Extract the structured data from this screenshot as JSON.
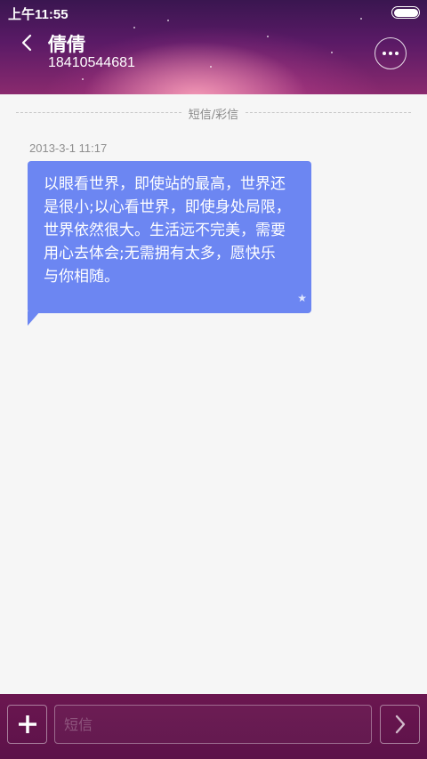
{
  "status_bar": {
    "time": "上午11:55",
    "battery_level": 1.0
  },
  "header": {
    "contact_name": "倩倩",
    "contact_number": "18410544681",
    "back_icon": "chevron-left-icon",
    "more_icon": "more-dots-icon"
  },
  "conversation": {
    "divider_label": "短信/彩信",
    "messages": [
      {
        "timestamp": "2013-3-1 11:17",
        "text": "以眼看世界，即使站的最高，世界还\n是很小;以心看世界，即使身处局限，\n世界依然很大。生活远不完美，需要\n用心去体会;无需拥有太多，愿快乐\n与你相随。",
        "starred": true,
        "bubble_color": "#6c86f2"
      }
    ]
  },
  "composer": {
    "add_icon": "plus-icon",
    "input_value": "",
    "input_placeholder": "短信",
    "send_icon": "chevron-right-icon"
  },
  "colors": {
    "header_purple": "#5a1a66",
    "bottom_bar": "#6b1650",
    "background": "#f6f6f6"
  }
}
